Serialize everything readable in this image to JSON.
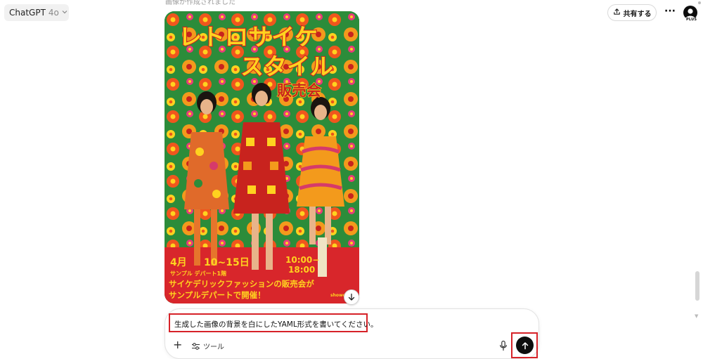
{
  "header": {
    "model_name": "ChatGPT",
    "model_version": "4o",
    "share_label": "共有する",
    "more_label": "···",
    "plan_badge": "PLUS"
  },
  "conversation": {
    "status_text": "画像が作成されました"
  },
  "poster": {
    "title_line1": "レトロサイケ",
    "title_line2": "スタイル",
    "title_line3": "販売会",
    "month": "4月",
    "dates": "10~15日",
    "time_start": "10:00−",
    "time_end": "18:00",
    "venue": "サンプル デパート1階",
    "tagline1": "サイケデリックファッションの販売会が",
    "tagline2": "サンプルデパートで開催！",
    "watermark": "showofor",
    "colors": {
      "background": "#2c8c3a",
      "banner": "#d8262b",
      "title_yellow": "#ffd21f",
      "title_red": "#c8231e"
    }
  },
  "composer": {
    "prompt_text": "生成した画像の背景を白にしたYAML形式を書いてください。",
    "add_label": "+",
    "tools_label": "ツール"
  },
  "icons": {
    "share": "upload-icon",
    "download": "arrow-down-icon",
    "mic": "microphone-icon",
    "send": "arrow-up-icon",
    "tools": "sliders-icon",
    "avatar": "user-icon"
  },
  "accent_colors": {
    "highlight_box": "#d62228",
    "send_button": "#0d0d0d"
  }
}
